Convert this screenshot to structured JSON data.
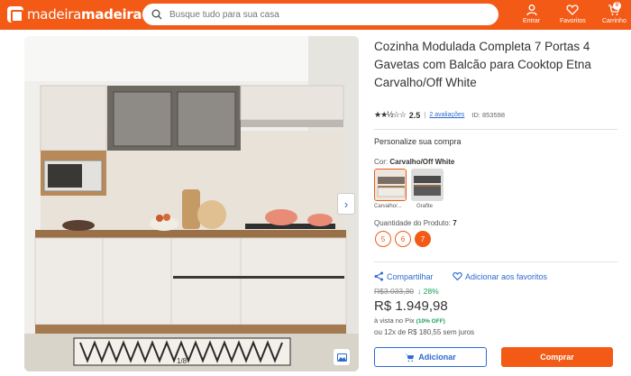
{
  "header": {
    "logo_part1": "madeira",
    "logo_part2": "madeira",
    "search_placeholder": "Busque tudo para sua casa",
    "enter_label": "Entrar",
    "favorites_label": "Favoritos",
    "cart_label": "Carrinho",
    "cart_count": "0",
    "bg_color": "#f25a16"
  },
  "gallery": {
    "counter": "1/8"
  },
  "product": {
    "title": "Cozinha Modulada Completa 7 Portas 4 Gavetas com Balcão para Cooktop Etna Carvalho/Off White",
    "rating": 2.5,
    "rating_stars": "★★½☆☆",
    "rating_value": "2.5",
    "reviews": "2 avaliações",
    "id_label": "ID: 853598",
    "personalize": "Personalize sua compra",
    "color_label": "Cor: ",
    "color_value": "Carvalho/Off White",
    "swatches": [
      {
        "label": "Carvalho/...",
        "selected": true
      },
      {
        "label": "Grafite",
        "selected": false
      }
    ],
    "qty_label": "Quantidade do Produto: ",
    "qty_value": "7",
    "qty_options": [
      "5",
      "6",
      "7"
    ],
    "share": "Compartilhar",
    "add_fav": "Adicionar aos favoritos",
    "old_price": "R$3.033,30",
    "discount": "↓ 28%",
    "price": "R$ 1.949,98",
    "pix_text": "à vista no Pix ",
    "pix_off": "(10% OFF)",
    "installments": "ou 12x de R$ 180,55 sem juros",
    "add_button": "Adicionar",
    "buy_button": "Comprar",
    "accent_color": "#2d6ad0"
  }
}
